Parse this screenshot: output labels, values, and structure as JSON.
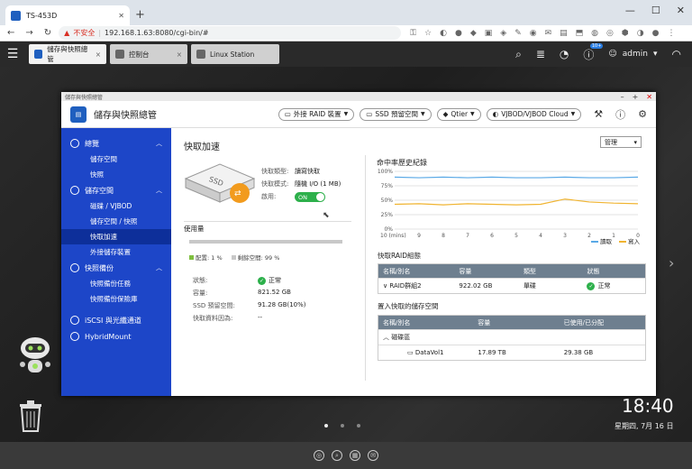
{
  "browser": {
    "tab_title": "TS-453D",
    "new_tab": "+",
    "security_label": "不安全",
    "url": "192.168.1.63:8080/cgi-bin/#"
  },
  "qts": {
    "tabs": [
      {
        "label": "儲存與快照總管",
        "close": "×"
      },
      {
        "label": "控制台",
        "close": "×"
      },
      {
        "label": "Linux Station",
        "close": "×"
      }
    ],
    "notification_badge": "10+",
    "username": "admin"
  },
  "desktop": {
    "time": "18:40",
    "date": "星期四, 7月 16 日"
  },
  "window": {
    "titlebar": "儲存與快照總管",
    "app_title": "儲存與快照總管",
    "header_buttons": [
      {
        "label": "外接 RAID 裝置"
      },
      {
        "label": "SSD 預留空間"
      },
      {
        "label": "Qtier"
      },
      {
        "label": "VJBOD/VJBOD Cloud"
      }
    ]
  },
  "sidebar": {
    "groups": [
      {
        "label": "總覽",
        "items": [
          "儲存空間",
          "快照"
        ]
      },
      {
        "label": "儲存空間",
        "items": [
          "磁碟 / VJBOD",
          "儲存空間 / 快照",
          "快取加速",
          "外接儲存裝置"
        ]
      },
      {
        "label": "快照備份",
        "items": [
          "快照備份任務",
          "快照備份保險庫"
        ]
      }
    ],
    "extra": [
      "iSCSI 與光纖通道",
      "HybridMount"
    ],
    "active": "快取加速"
  },
  "cache": {
    "title": "快取加速",
    "manage_button": "管理",
    "type_label": "快取類型:",
    "type_value": "讀寫快取",
    "mode_label": "快取模式:",
    "mode_value": "隨機 I/O (1 MB)",
    "enable_label": "啟用:",
    "toggle_label": "ON",
    "usage_title": "使用量",
    "usage_fraction": 0.99,
    "configured_label": "配置: 1 %",
    "free_label": "剩餘空間: 99 %",
    "status_label": "狀態:",
    "status_value": "正常",
    "capacity_label": "容量:",
    "capacity_value": "821.52 GB",
    "ssd_reserve_label": "SSD 預留空間:",
    "ssd_reserve_value": "91.28 GB(10%)",
    "cache_data_label": "快取資料因為:",
    "cache_data_value": "--",
    "ssd_icon_text": "SSD"
  },
  "hit_chart": {
    "title": "命中率歷史紀錄",
    "x_unit_label": "10 (mins)",
    "legend": [
      "讀取",
      "寫入"
    ],
    "colors": {
      "read": "#5aa9e6",
      "write": "#f0b431"
    }
  },
  "chart_data": {
    "type": "line",
    "title": "命中率歷史紀錄",
    "x": [
      10,
      9,
      8,
      7,
      6,
      5,
      4,
      3,
      2,
      1,
      0
    ],
    "xtick_labels": [
      "10 (mins)",
      "9",
      "8",
      "7",
      "6",
      "5",
      "4",
      "3",
      "2",
      "1",
      "0"
    ],
    "ytick_labels": [
      "100%",
      "75%",
      "50%",
      "25%",
      "0%"
    ],
    "ylim": [
      0,
      100
    ],
    "series": [
      {
        "name": "讀取",
        "values": [
          90,
          89,
          90,
          89,
          90,
          89,
          89,
          90,
          89,
          89,
          90
        ]
      },
      {
        "name": "寫入",
        "values": [
          43,
          44,
          42,
          44,
          43,
          42,
          43,
          52,
          47,
          45,
          44
        ]
      }
    ],
    "legend_position": "bottom-right"
  },
  "raid_group": {
    "title": "快取RAID組態",
    "headers": [
      "名稱/別名",
      "容量",
      "類型",
      "狀態"
    ],
    "rows": [
      {
        "name": "RAID群組2",
        "capacity": "922.02 GB",
        "type": "單碟",
        "status": "正常"
      }
    ]
  },
  "accel_space": {
    "title": "置入快取的儲存空間",
    "headers": [
      "名稱/別名",
      "容量",
      "已使用/已分配"
    ],
    "pool": "磁碟區",
    "rows": [
      {
        "name": "DataVol1",
        "capacity": "17.89 TB",
        "used": "29.38 GB"
      }
    ]
  }
}
